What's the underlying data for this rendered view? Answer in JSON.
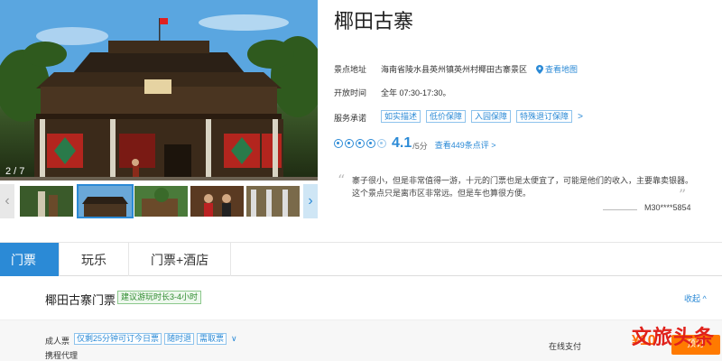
{
  "hero": {
    "counter": "2 / 7"
  },
  "scenic": {
    "title": "椰田古寨",
    "address_label": "景点地址",
    "address": "海南省陵水县英州镇英州村椰田古寨景区",
    "map_link": "查看地图",
    "hours_label": "开放时间",
    "hours": "全年 07:30-17:30。",
    "promise_label": "服务承诺",
    "promises": [
      "如实描述",
      "低价保障",
      "入园保障",
      "特殊退订保障"
    ],
    "promise_more": ">",
    "rating": {
      "score": "4.1",
      "max": "/5分",
      "filled": 4,
      "review_link": "查看449条点评 >"
    }
  },
  "review": {
    "open_quote": "“",
    "close_quote": "”",
    "text": "寨子很小，但是非常值得一游，十元的门票也是太便宜了，可能是他们的收入，主要靠卖银器。这个景点只是离市区非常远。但是车也算很方便。",
    "user": "M30****5854"
  },
  "tabs": [
    "门票",
    "玩乐",
    "门票+酒店"
  ],
  "ticket": {
    "title": "椰田古寨门票",
    "badge": "建议游玩时长3-4小时",
    "collapse": "收起 ^",
    "type": "成人票",
    "tags": [
      "仅剩25分钟可订今日票",
      "随时退",
      "需取票"
    ],
    "more": "∨",
    "agent": "携程代理",
    "payment": "在线支付",
    "price": "¥10",
    "book": "预订"
  },
  "watermark": "文旅头条",
  "colors": {
    "accent": "#2b8ad6",
    "price": "#ff6a00",
    "book": "#ff7a00"
  }
}
